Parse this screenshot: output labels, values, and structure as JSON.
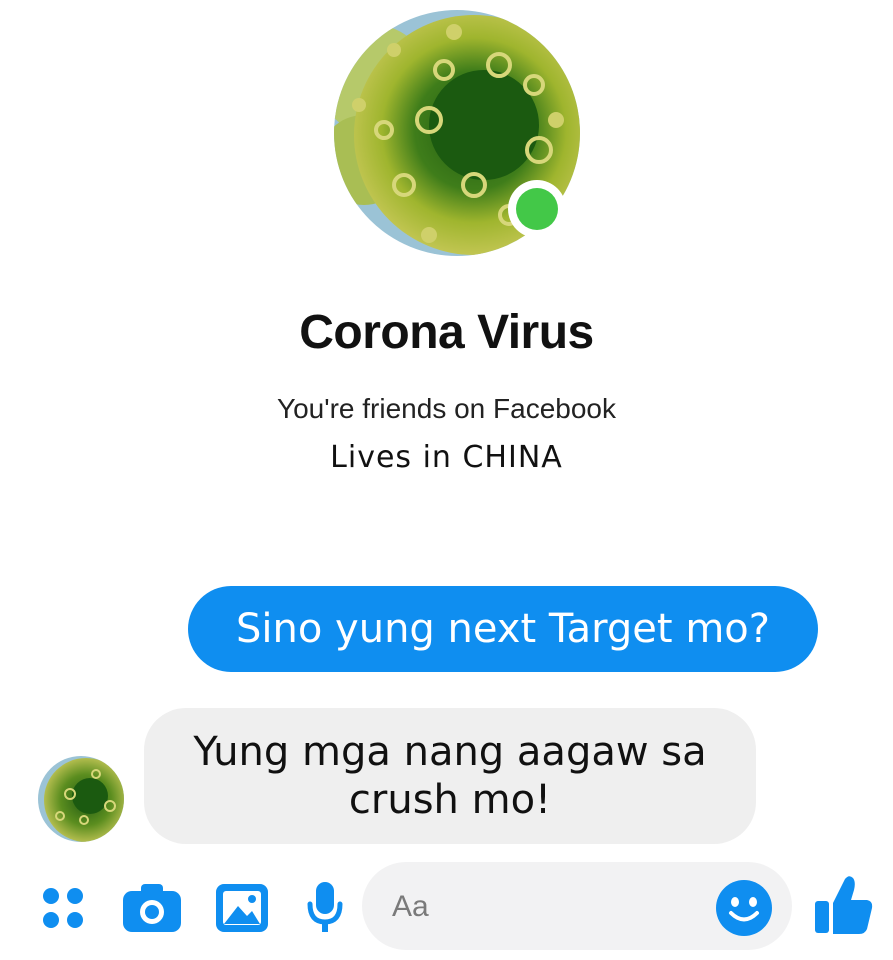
{
  "profile": {
    "name": "Corona Virus",
    "friends_text": "You're friends on Facebook",
    "location_text": "Lives in CHINA",
    "online": true
  },
  "messages": [
    {
      "direction": "outgoing",
      "text": "Sino yung next Target mo?"
    },
    {
      "direction": "incoming",
      "lines": [
        "Yung mga nang aagaw sa",
        "crush mo!"
      ]
    }
  ],
  "composer": {
    "placeholder": "Aa",
    "icons": [
      "apps-icon",
      "camera-icon",
      "image-icon",
      "microphone-icon",
      "emoji-icon",
      "thumbs-up-icon"
    ]
  },
  "colors": {
    "messenger_blue": "#0f8ef0",
    "online_green": "#43c848",
    "incoming_bubble": "#efefef",
    "composer_bg": "#f2f2f3"
  }
}
